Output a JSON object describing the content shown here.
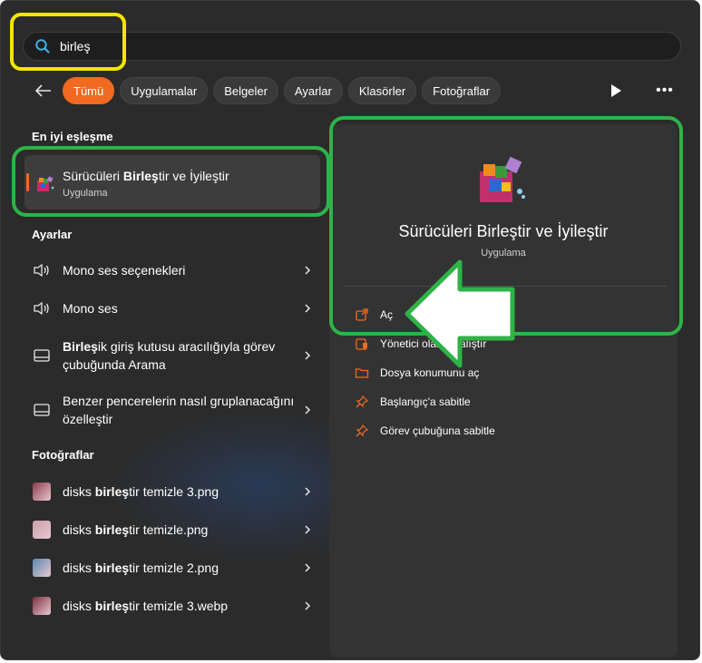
{
  "search": {
    "value": "birleş"
  },
  "filters": {
    "back_label": "Geri",
    "chips": [
      {
        "label": "Tümü",
        "active": true
      },
      {
        "label": "Uygulamalar",
        "active": false
      },
      {
        "label": "Belgeler",
        "active": false
      },
      {
        "label": "Ayarlar",
        "active": false
      },
      {
        "label": "Klasörler",
        "active": false
      },
      {
        "label": "Fotoğraflar",
        "active": false
      }
    ]
  },
  "best_match": {
    "heading": "En iyi eşleşme",
    "title_pre": "Sürücüleri ",
    "title_bold": "Birleş",
    "title_post": "tir ve İyileştir",
    "subtitle": "Uygulama"
  },
  "settings": {
    "heading": "Ayarlar",
    "items": [
      {
        "pre": "",
        "bold": "",
        "post": "Mono ses seçenekleri",
        "icon": "speaker-icon"
      },
      {
        "pre": "",
        "bold": "",
        "post": "Mono ses",
        "icon": "speaker-icon"
      },
      {
        "pre": "",
        "bold": "Birleş",
        "post": "ik giriş kutusu aracılığıyla görev çubuğunda Arama",
        "icon": "taskbar-icon"
      },
      {
        "pre": "",
        "bold": "",
        "post": "Benzer pencerelerin nasıl gruplanacağını özelleştir",
        "icon": "taskbar-icon"
      }
    ]
  },
  "photos": {
    "heading": "Fotoğraflar",
    "items": [
      {
        "pre": "disks ",
        "bold": "birleş",
        "post": "tir temizle 3.png",
        "thumb_color": "#8a3a4a"
      },
      {
        "pre": "disks ",
        "bold": "birleş",
        "post": "tir temizle.png",
        "thumb_color": "#c9a0a8"
      },
      {
        "pre": "disks ",
        "bold": "birleş",
        "post": "tir temizle 2.png",
        "thumb_color": "#5a8ab0"
      },
      {
        "pre": "disks ",
        "bold": "birleş",
        "post": "tir temizle 3.webp",
        "thumb_color": "#7a3040"
      }
    ]
  },
  "detail": {
    "title": "Sürücüleri Birleştir ve İyileştir",
    "subtitle": "Uygulama",
    "actions": [
      {
        "label": "Aç",
        "icon": "open-icon"
      },
      {
        "label": "Yönetici olarak çalıştır",
        "icon": "shield-icon"
      },
      {
        "label": "Dosya konumunu aç",
        "icon": "folder-icon"
      },
      {
        "label": "Başlangıç'a sabitle",
        "icon": "pin-icon"
      },
      {
        "label": "Görev çubuğuna sabitle",
        "icon": "pin-icon"
      }
    ]
  },
  "colors": {
    "accent": "#f06a22",
    "highlight_green": "#2eb347",
    "highlight_yellow": "#f5e400"
  }
}
